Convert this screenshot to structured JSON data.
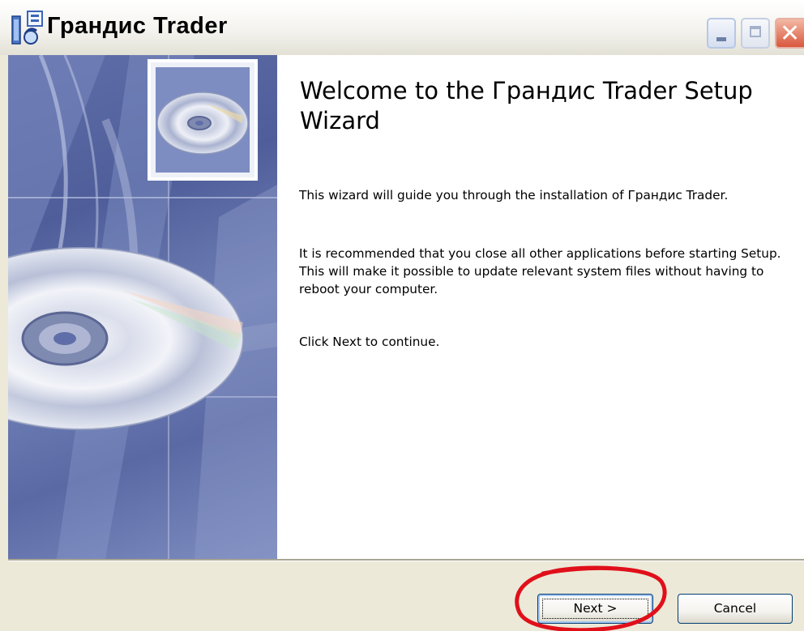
{
  "window": {
    "title": "Грандис Trader",
    "controls": {
      "minimize": "minimize-icon",
      "maximize": "maximize-icon",
      "close": "close-icon"
    }
  },
  "wizard": {
    "heading": "Welcome to the Грандис Trader Setup Wizard",
    "paragraphs": [
      "This wizard will guide you through the installation of Грандис Trader.",
      "It is recommended that you close all other applications before starting Setup. This will make it possible to update relevant system files without having to reboot your computer.",
      "Click Next to continue."
    ]
  },
  "buttons": {
    "next": "Next >",
    "cancel": "Cancel"
  },
  "colors": {
    "dialog_bg": "#ece9d8",
    "content_bg": "#ffffff",
    "side_art": "#5f6ea8",
    "annotation": "#e0101a",
    "close_button": "#d9573d"
  }
}
